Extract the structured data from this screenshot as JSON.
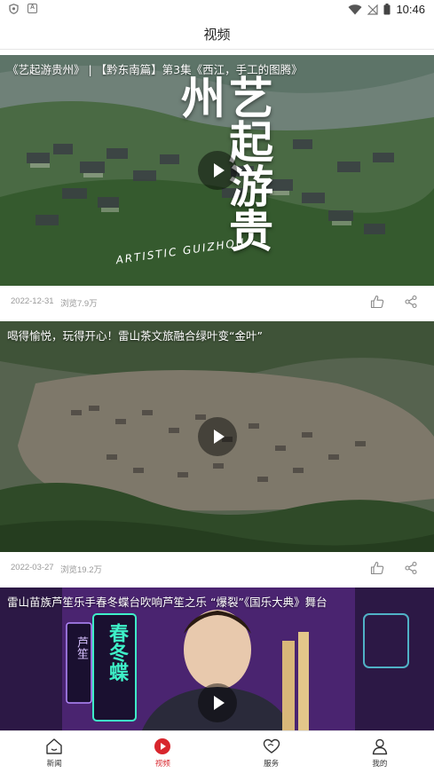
{
  "status_bar": {
    "time": "10:46",
    "left_icons": [
      "shield-icon",
      "a-icon"
    ],
    "right_icons": [
      "wifi-icon",
      "signal-off-icon",
      "battery-icon"
    ]
  },
  "header": {
    "title": "视频"
  },
  "feed": [
    {
      "caption": "《艺起游贵州》 | 【黔东南篇】第3集《西江，手工的图腾》",
      "overlay_title": "艺起游贵州",
      "overlay_sub": "ARTISTIC GUIZHOU",
      "date": "2022-12-31",
      "views": "浏览7.9万"
    },
    {
      "caption": "喝得愉悦，玩得开心！雷山茶文旅融合绿叶变“金叶”",
      "date": "2022-03-27",
      "views": "浏览19.2万"
    },
    {
      "caption": "雷山苗族芦笙乐手春冬蝶台吹响芦笙之乐 “爆裂”《国乐大典》舞台",
      "poster_text_1": "春冬蝶",
      "poster_text_2": "芦笙"
    }
  ],
  "bottom_nav": [
    {
      "label": "新闻",
      "icon": "home-icon",
      "active": false
    },
    {
      "label": "视频",
      "icon": "video-play-icon",
      "active": true
    },
    {
      "label": "服务",
      "icon": "heart-icon",
      "active": false
    },
    {
      "label": "我的",
      "icon": "person-icon",
      "active": false
    }
  ],
  "colors": {
    "accent": "#d8262d",
    "meta_text": "#999999"
  }
}
